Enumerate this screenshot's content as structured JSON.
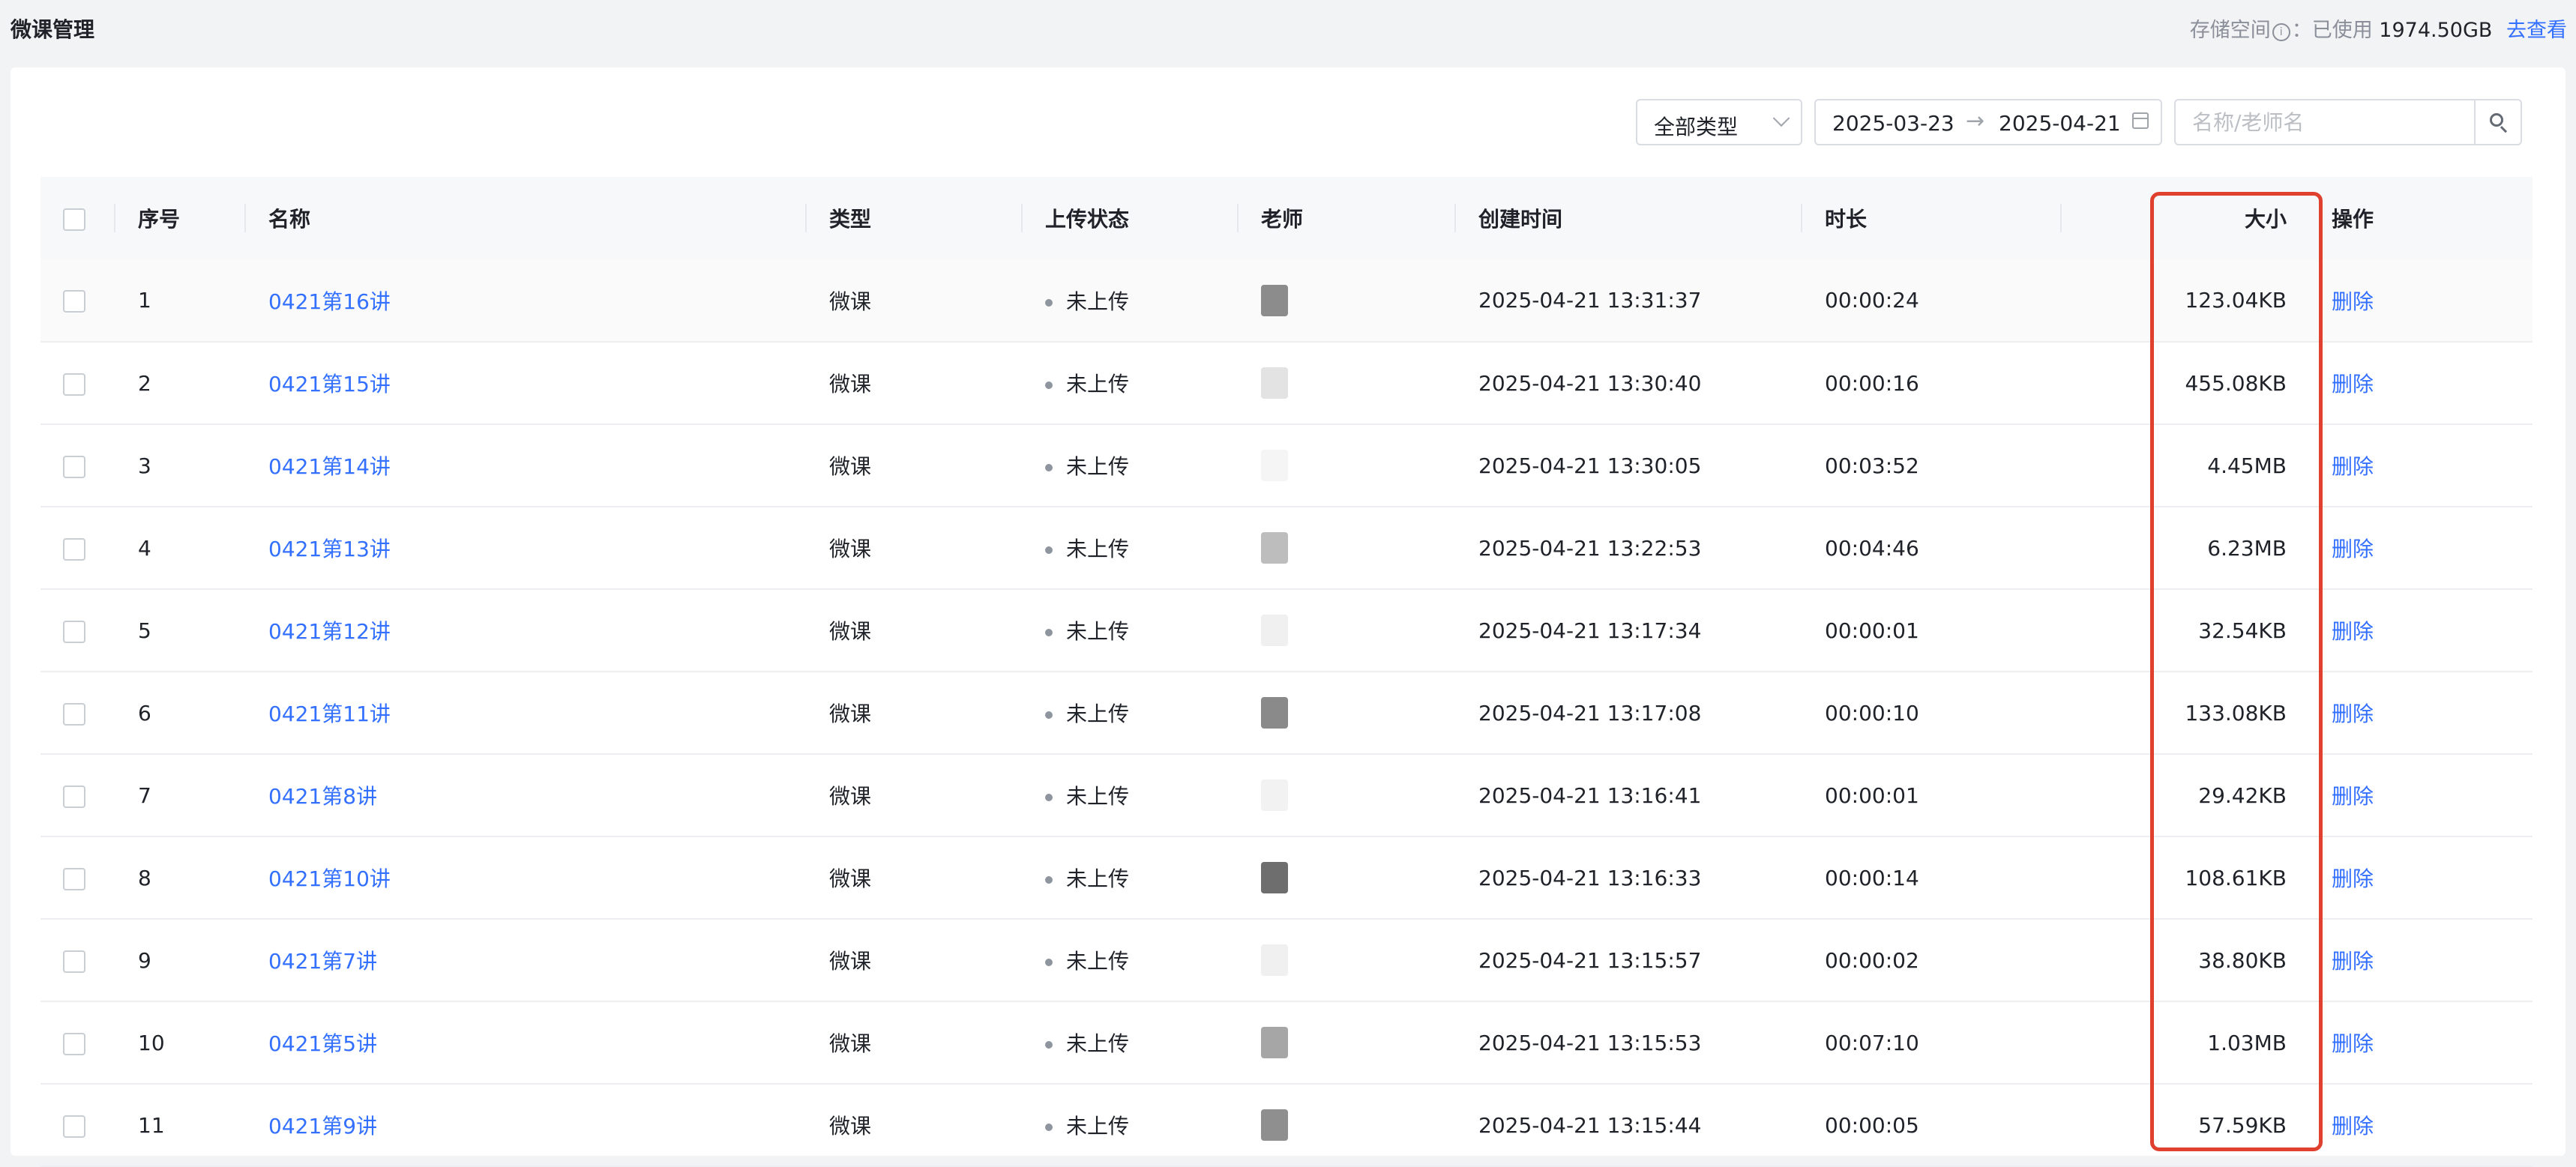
{
  "header": {
    "title": "微课管理",
    "storage_label": "存储空间",
    "storage_used_prefix": "：已使用",
    "storage_used_value": "1974.50GB",
    "storage_link": "去查看"
  },
  "filters": {
    "type_select": "全部类型",
    "date_start": "2025-03-23",
    "date_end": "2025-04-21",
    "date_separator": "→",
    "search_placeholder": "名称/老师名"
  },
  "table": {
    "columns": {
      "index": "序号",
      "name": "名称",
      "type": "类型",
      "status": "上传状态",
      "teacher": "老师",
      "created": "创建时间",
      "duration": "时长",
      "size": "大小",
      "actions": "操作"
    },
    "rows": [
      {
        "index": "1",
        "name": "0421第16讲",
        "type": "微课",
        "status": "未上传",
        "created": "2025-04-21 13:31:37",
        "duration": "00:00:24",
        "size": "123.04KB",
        "action": "删除"
      },
      {
        "index": "2",
        "name": "0421第15讲",
        "type": "微课",
        "status": "未上传",
        "created": "2025-04-21 13:30:40",
        "duration": "00:00:16",
        "size": "455.08KB",
        "action": "删除"
      },
      {
        "index": "3",
        "name": "0421第14讲",
        "type": "微课",
        "status": "未上传",
        "created": "2025-04-21 13:30:05",
        "duration": "00:03:52",
        "size": "4.45MB",
        "action": "删除"
      },
      {
        "index": "4",
        "name": "0421第13讲",
        "type": "微课",
        "status": "未上传",
        "created": "2025-04-21 13:22:53",
        "duration": "00:04:46",
        "size": "6.23MB",
        "action": "删除"
      },
      {
        "index": "5",
        "name": "0421第12讲",
        "type": "微课",
        "status": "未上传",
        "created": "2025-04-21 13:17:34",
        "duration": "00:00:01",
        "size": "32.54KB",
        "action": "删除"
      },
      {
        "index": "6",
        "name": "0421第11讲",
        "type": "微课",
        "status": "未上传",
        "created": "2025-04-21 13:17:08",
        "duration": "00:00:10",
        "size": "133.08KB",
        "action": "删除"
      },
      {
        "index": "7",
        "name": "0421第8讲",
        "type": "微课",
        "status": "未上传",
        "created": "2025-04-21 13:16:41",
        "duration": "00:00:01",
        "size": "29.42KB",
        "action": "删除"
      },
      {
        "index": "8",
        "name": "0421第10讲",
        "type": "微课",
        "status": "未上传",
        "created": "2025-04-21 13:16:33",
        "duration": "00:00:14",
        "size": "108.61KB",
        "action": "删除"
      },
      {
        "index": "9",
        "name": "0421第7讲",
        "type": "微课",
        "status": "未上传",
        "created": "2025-04-21 13:15:57",
        "duration": "00:00:02",
        "size": "38.80KB",
        "action": "删除"
      },
      {
        "index": "10",
        "name": "0421第5讲",
        "type": "微课",
        "status": "未上传",
        "created": "2025-04-21 13:15:53",
        "duration": "00:07:10",
        "size": "1.03MB",
        "action": "删除"
      },
      {
        "index": "11",
        "name": "0421第9讲",
        "type": "微课",
        "status": "未上传",
        "created": "2025-04-21 13:15:44",
        "duration": "00:00:05",
        "size": "57.59KB",
        "action": "删除"
      }
    ],
    "teacher_avatar_colors": [
      "#8c8c8c",
      "#e3e3e3",
      "#f5f5f5",
      "#bdbdbd",
      "#f0f0f0",
      "#8a8a8a",
      "#f2f2f2",
      "#6e6e6e",
      "#f0f0f0",
      "#a6a6a6",
      "#8f8f8f"
    ]
  },
  "colors": {
    "link": "#3370ff",
    "highlight": "#e0402e"
  }
}
